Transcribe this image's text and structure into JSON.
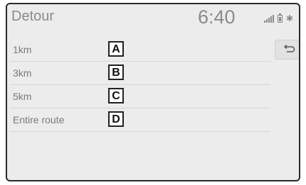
{
  "header": {
    "title": "Detour",
    "clock": "6:40",
    "icons": [
      "signal-icon",
      "battery-icon",
      "bluetooth-icon"
    ]
  },
  "detour_options": [
    {
      "label": "1km",
      "marker": "A"
    },
    {
      "label": "3km",
      "marker": "B"
    },
    {
      "label": "5km",
      "marker": "C"
    },
    {
      "label": "Entire route",
      "marker": "D"
    }
  ],
  "back_button": {
    "icon": "back-arrow-icon"
  }
}
